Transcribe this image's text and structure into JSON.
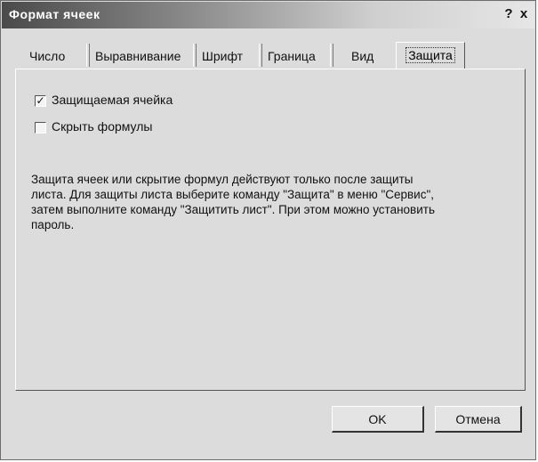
{
  "window": {
    "title": "Формат ячеек",
    "help_label": "?",
    "close_label": "x"
  },
  "tabs": [
    {
      "label": "Число"
    },
    {
      "label": "Выравнивание"
    },
    {
      "label": "Шрифт"
    },
    {
      "label": "Граница"
    },
    {
      "label": "Вид"
    },
    {
      "label": "Защита",
      "active": true
    }
  ],
  "protection": {
    "protected_label": "Защищаемая ячейка",
    "protected_checked": true,
    "hide_formulas_label": "Скрыть формулы",
    "hide_formulas_checked": false,
    "info_text": "Защита ячеек или скрытие формул действуют только после защиты листа. Для защиты листа выберите команду \"Защита\" в меню \"Сервис\", затем выполните команду \"Защитить лист\". При этом можно установить пароль."
  },
  "buttons": {
    "ok_label": "OK",
    "cancel_label": "Отмена"
  }
}
